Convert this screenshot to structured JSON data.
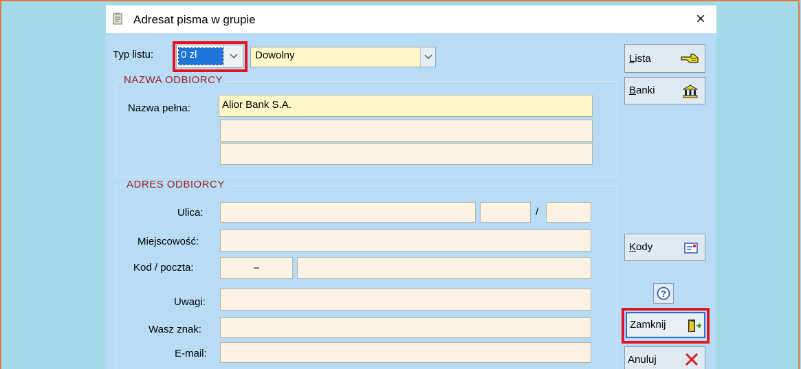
{
  "window": {
    "title": "Adresat pisma w grupie",
    "close_glyph": "×"
  },
  "typ": {
    "label": "Typ listu:",
    "price_value": "0 zł",
    "kind_value": "Dowolny"
  },
  "nazwa": {
    "group_title": "NAZWA ODBIORCY",
    "label": "Nazwa pełna:",
    "line1": "Alior Bank S.A.",
    "line2": "",
    "line3": ""
  },
  "adres": {
    "group_title": "ADRES ODBIORCY",
    "ulica_label": "Ulica:",
    "slash": "/",
    "miejscowosc_label": "Miejscowość:",
    "kod_label": "Kod / poczta:",
    "kod_value": "–",
    "uwagi_label": "Uwagi:",
    "wasz_znak_label": "Wasz znak:",
    "email_label": "E-mail:"
  },
  "buttons": {
    "lista": {
      "underline": "L",
      "rest": "ista",
      "icon": "pointing-hand-icon"
    },
    "banki": {
      "underline": "B",
      "rest": "anki",
      "icon": "bank-icon"
    },
    "kody": {
      "underline": "K",
      "rest": "ody",
      "icon": "envelope-icon"
    },
    "help": {
      "glyph": "?",
      "icon": "help-icon"
    },
    "zamknij": {
      "label": "Zamknij",
      "icon": "exit-door-icon"
    },
    "anuluj": {
      "label": "Anuluj",
      "icon": "cancel-x-icon"
    }
  },
  "colors": {
    "desktop": "#a5dbe9",
    "dialog": "#b9dcf6",
    "field": "#fdf3e4",
    "field_yellow": "#fff7c8",
    "group_title": "#a0201e",
    "highlight": "#e3141f"
  }
}
